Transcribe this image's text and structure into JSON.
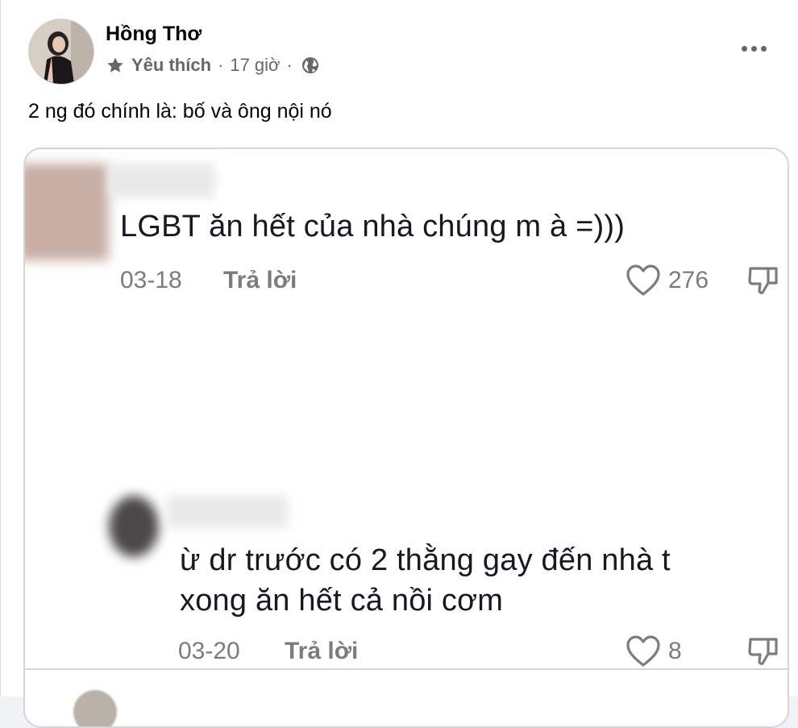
{
  "post": {
    "author": "Hồng Thơ",
    "favorite_label": "Yêu thích",
    "separator": "·",
    "time": "17 giờ",
    "caption": "2 ng đó chính là: bố và ông nội nó"
  },
  "comments": [
    {
      "text": "LGBT ăn hết của nhà chúng m à =)))",
      "date": "03-18",
      "reply_label": "Trả lời",
      "likes": "276"
    },
    {
      "text_lines": [
        "ừ dr trước có 2 thằng gay đến nhà t",
        "xong ăn hết cả nồi cơm"
      ],
      "date": "03-20",
      "reply_label": "Trả lời",
      "likes": "8"
    }
  ],
  "colors": {
    "secondary_text": "#65676b",
    "comment_text": "#161823",
    "comment_meta": "#7b7c80"
  },
  "icons": {
    "star": "star-icon",
    "globe": "globe-icon",
    "more": "more-horizontal-icon",
    "heart": "heart-icon",
    "dislike": "thumbs-down-icon"
  }
}
